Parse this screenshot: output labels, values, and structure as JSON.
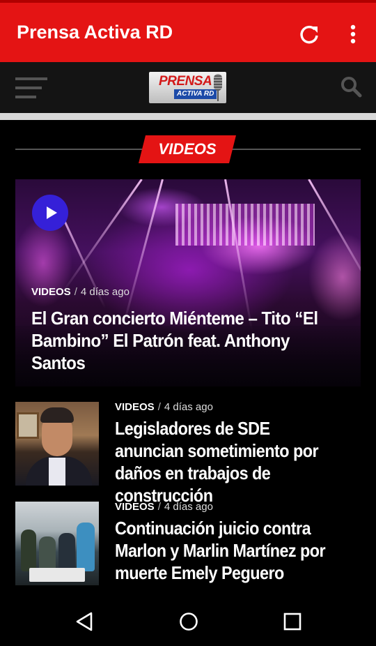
{
  "appbar": {
    "title": "Prensa Activa RD",
    "icons": [
      "refresh-icon",
      "more-vert-icon"
    ],
    "color": "#e41414"
  },
  "header": {
    "logo": {
      "main": "PRENSA",
      "sub": "ACTIVA RD"
    },
    "icons": [
      "hamburger-menu-icon",
      "search-icon"
    ]
  },
  "section": {
    "label": "VIDEOS",
    "accent": "#e41414"
  },
  "featured": {
    "category": "VIDEOS",
    "separator": "/",
    "time": "4 días ago",
    "title": "El Gran concierto Miénteme – Tito “El Bambino” El Patrón feat. Anthony Santos"
  },
  "items": [
    {
      "category": "VIDEOS",
      "separator": "/",
      "time": "4 días ago",
      "title": "Legisladores de SDE anuncian sometimiento por daños en trabajos de construcción"
    },
    {
      "category": "VIDEOS",
      "separator": "/",
      "time": "4 días ago",
      "title": "Continuación juicio contra Marlon y Marlin Martínez por muerte Emely Peguero"
    }
  ],
  "navbar": {
    "icons": [
      "back-icon",
      "home-icon",
      "recent-apps-icon"
    ]
  }
}
